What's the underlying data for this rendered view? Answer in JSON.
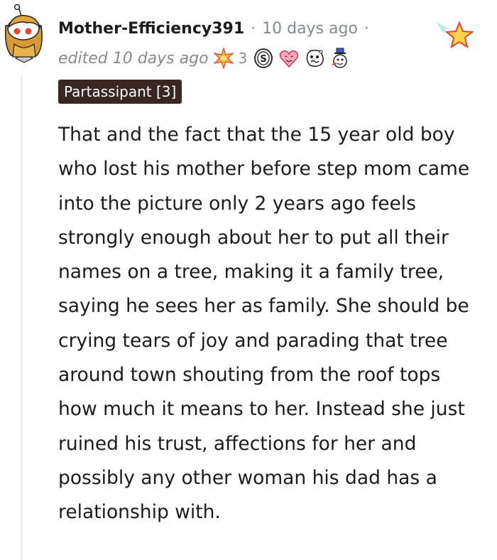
{
  "comment": {
    "username": "Mother-Efficiency391",
    "separator": "·",
    "timestamp": "10 days ago",
    "edited_label": "edited 10 days ago",
    "award_count": "3",
    "flair": "Partassipant [3]",
    "body": "That and the fact that the 15 year old boy who lost his mother before step mom came into the picture only 2 years ago feels strongly enough about her to put all their names on a tree, making it a family tree, saying he sees her as family. She should be crying tears of joy and parading that tree around town shouting from the roof tops how much it means to her. Instead she just ruined his trust, affections for her and possibly any other woman his dad has a relationship with."
  },
  "awards": [
    {
      "icon": "starburst-award-icon"
    },
    {
      "icon": "silver-coin-award-icon"
    },
    {
      "icon": "heart-eyes-award-icon"
    },
    {
      "icon": "confused-face-award-icon"
    },
    {
      "icon": "snowman-award-icon"
    }
  ],
  "colors": {
    "flair_bg": "#3b2721",
    "meta_gray": "#878a8c",
    "text": "#1c1c1c"
  }
}
